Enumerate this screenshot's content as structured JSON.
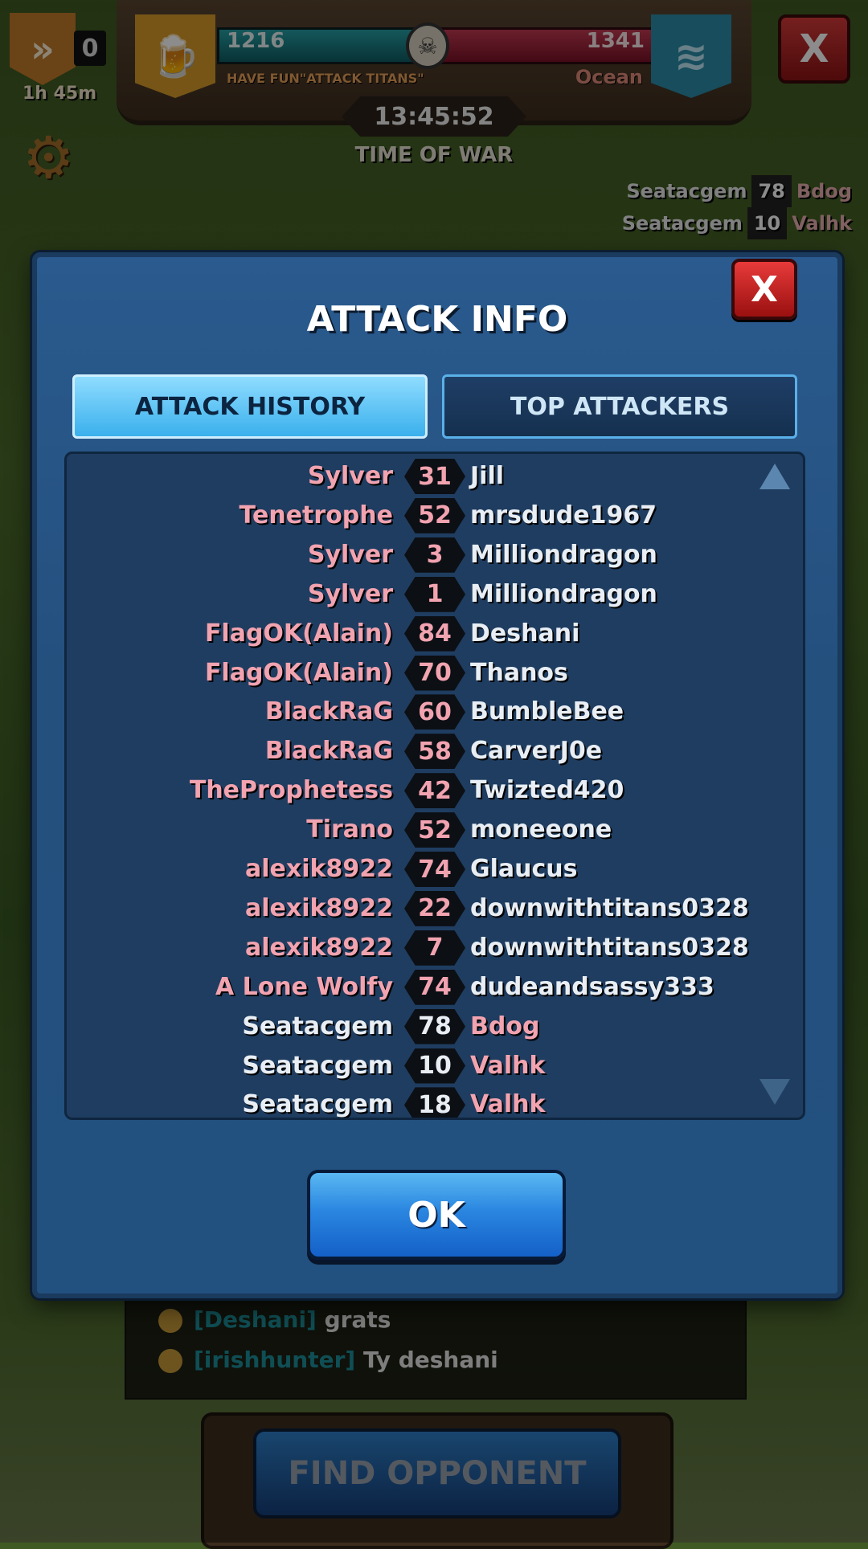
{
  "hud": {
    "rank_count": "0",
    "rank_time": "1h 45m",
    "left_score": "1216",
    "right_score": "1341",
    "left_clan": "HAVE FUN\"ATTACK TITANS\"",
    "right_clan": "Ocean",
    "timer": "13:45:52",
    "war_label": "TIME OF WAR",
    "close_label": "X"
  },
  "feed": [
    {
      "attacker": "Seatacgem",
      "score": "78",
      "defender": "Bdog"
    },
    {
      "attacker": "Seatacgem",
      "score": "10",
      "defender": "Valhk"
    }
  ],
  "modal": {
    "title": "ATTACK INFO",
    "close_label": "X",
    "tabs": [
      {
        "label": "ATTACK HISTORY",
        "active": true
      },
      {
        "label": "TOP ATTACKERS",
        "active": false
      }
    ],
    "ok_label": "OK"
  },
  "attack_history": [
    {
      "attacker": "Sylver",
      "score": "31",
      "defender": "Jill",
      "attacker_color": "red"
    },
    {
      "attacker": "Tenetrophe",
      "score": "52",
      "defender": "mrsdude1967",
      "attacker_color": "red"
    },
    {
      "attacker": "Sylver",
      "score": "3",
      "defender": "Milliondragon",
      "attacker_color": "red"
    },
    {
      "attacker": "Sylver",
      "score": "1",
      "defender": "Milliondragon",
      "attacker_color": "red"
    },
    {
      "attacker": "FlagOK(Alain)",
      "score": "84",
      "defender": "Deshani",
      "attacker_color": "red"
    },
    {
      "attacker": "FlagOK(Alain)",
      "score": "70",
      "defender": "Thanos",
      "attacker_color": "red"
    },
    {
      "attacker": "BlackRaG",
      "score": "60",
      "defender": "BumbleBee",
      "attacker_color": "red"
    },
    {
      "attacker": "BlackRaG",
      "score": "58",
      "defender": "CarverJ0e",
      "attacker_color": "red"
    },
    {
      "attacker": "TheProphetess",
      "score": "42",
      "defender": "Twizted420",
      "attacker_color": "red"
    },
    {
      "attacker": "Tirano",
      "score": "52",
      "defender": "moneeone",
      "attacker_color": "red"
    },
    {
      "attacker": "alexik8922",
      "score": "74",
      "defender": "Glaucus",
      "attacker_color": "red"
    },
    {
      "attacker": "alexik8922",
      "score": "22",
      "defender": "downwithtitans0328",
      "attacker_color": "red"
    },
    {
      "attacker": "alexik8922",
      "score": "7",
      "defender": "downwithtitans0328",
      "attacker_color": "red"
    },
    {
      "attacker": "A Lone Wolfy",
      "score": "74",
      "defender": "dudeandsassy333",
      "attacker_color": "red"
    },
    {
      "attacker": "Seatacgem",
      "score": "78",
      "defender": "Bdog",
      "attacker_color": "white"
    },
    {
      "attacker": "Seatacgem",
      "score": "10",
      "defender": "Valhk",
      "attacker_color": "white"
    },
    {
      "attacker": "Seatacgem",
      "score": "18",
      "defender": "Valhk",
      "attacker_color": "white"
    }
  ],
  "chat": [
    {
      "name": "[Deshani]",
      "text": "grats"
    },
    {
      "name": "[irishhunter]",
      "text": "Ty deshani"
    }
  ],
  "find_opponent_label": "FIND OPPONENT",
  "colors": {
    "accent_red": "#f2a3b0",
    "accent_blue": "#3ab0ec",
    "ok_blue": "#2a86e0"
  }
}
